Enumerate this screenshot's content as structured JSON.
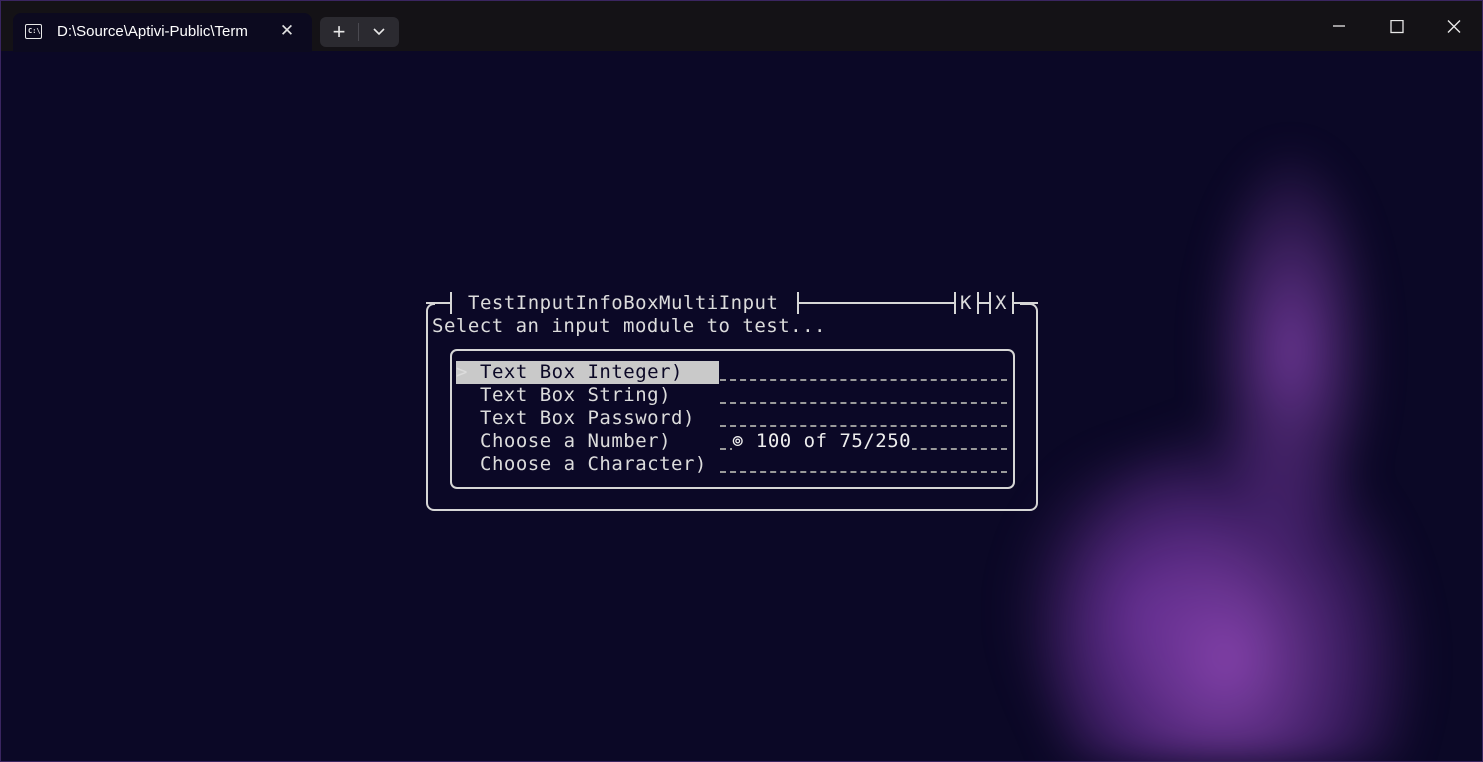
{
  "window": {
    "tab_title": "D:\\Source\\Aptivi-Public\\Term",
    "tab_icon": "terminal-icon",
    "tab_icon_glyph": "C:\\",
    "close_tab_glyph": "✕",
    "new_tab_glyph": "+",
    "accent_color": "#0b0826"
  },
  "dialog": {
    "title": "TestInputInfoBoxMultiInput",
    "button_k": "K",
    "button_x": "X",
    "prompt": "Select an input module to test...",
    "cursor": ">",
    "items": [
      {
        "label": "Text Box Integer)",
        "value": "",
        "selected": true
      },
      {
        "label": "Text Box String)",
        "value": "",
        "selected": false
      },
      {
        "label": "Text Box Password)",
        "value": "",
        "selected": false
      },
      {
        "label": "Choose a Number)",
        "value": "⊚ 100 of 75/250",
        "selected": false
      },
      {
        "label": "Choose a Character)",
        "value": "",
        "selected": false
      }
    ]
  }
}
